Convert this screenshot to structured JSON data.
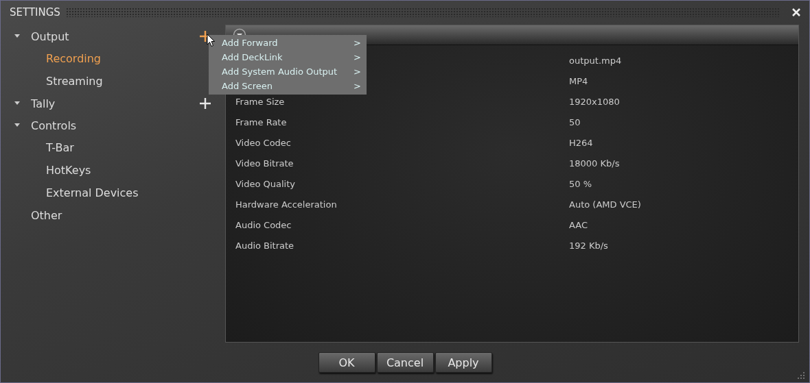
{
  "window": {
    "title": "SETTINGS"
  },
  "tree": [
    {
      "label": "Output",
      "expanded": true,
      "selected": false,
      "add_button": true,
      "add_highlighted": true,
      "children": [
        {
          "label": "Recording",
          "selected": true
        },
        {
          "label": "Streaming",
          "selected": false
        }
      ]
    },
    {
      "label": "Tally",
      "expanded": true,
      "selected": false,
      "add_button": true,
      "add_highlighted": false
    },
    {
      "label": "Controls",
      "expanded": true,
      "selected": false,
      "children": [
        {
          "label": "T-Bar",
          "selected": false
        },
        {
          "label": "HotKeys",
          "selected": false
        },
        {
          "label": "External Devices",
          "selected": false
        }
      ]
    },
    {
      "label": "Other",
      "selected": false
    }
  ],
  "panel": {
    "rows": [
      {
        "value": "output.mp4"
      },
      {
        "value": "MP4"
      },
      {
        "label": "Frame Size",
        "value": "1920x1080"
      },
      {
        "label": "Frame Rate",
        "value": "50"
      },
      {
        "label": "Video Codec",
        "value": "H264"
      },
      {
        "label": "Video Bitrate",
        "value": "18000 Kb/s"
      },
      {
        "label": "Video Quality",
        "value": "50 %"
      },
      {
        "label": "Hardware Acceleration",
        "value": "Auto (AMD VCE)"
      },
      {
        "label": "Audio Codec",
        "value": "AAC"
      },
      {
        "label": "Audio Bitrate",
        "value": "192 Kb/s"
      }
    ]
  },
  "context_menu": [
    {
      "label": "Add Forward",
      "submenu": ">"
    },
    {
      "label": "Add DeckLink",
      "submenu": ">"
    },
    {
      "label": "Add System Audio Output",
      "submenu": ">"
    },
    {
      "label": "Add Screen",
      "submenu": ">"
    }
  ],
  "buttons": [
    "OK",
    "Cancel",
    "Apply"
  ]
}
